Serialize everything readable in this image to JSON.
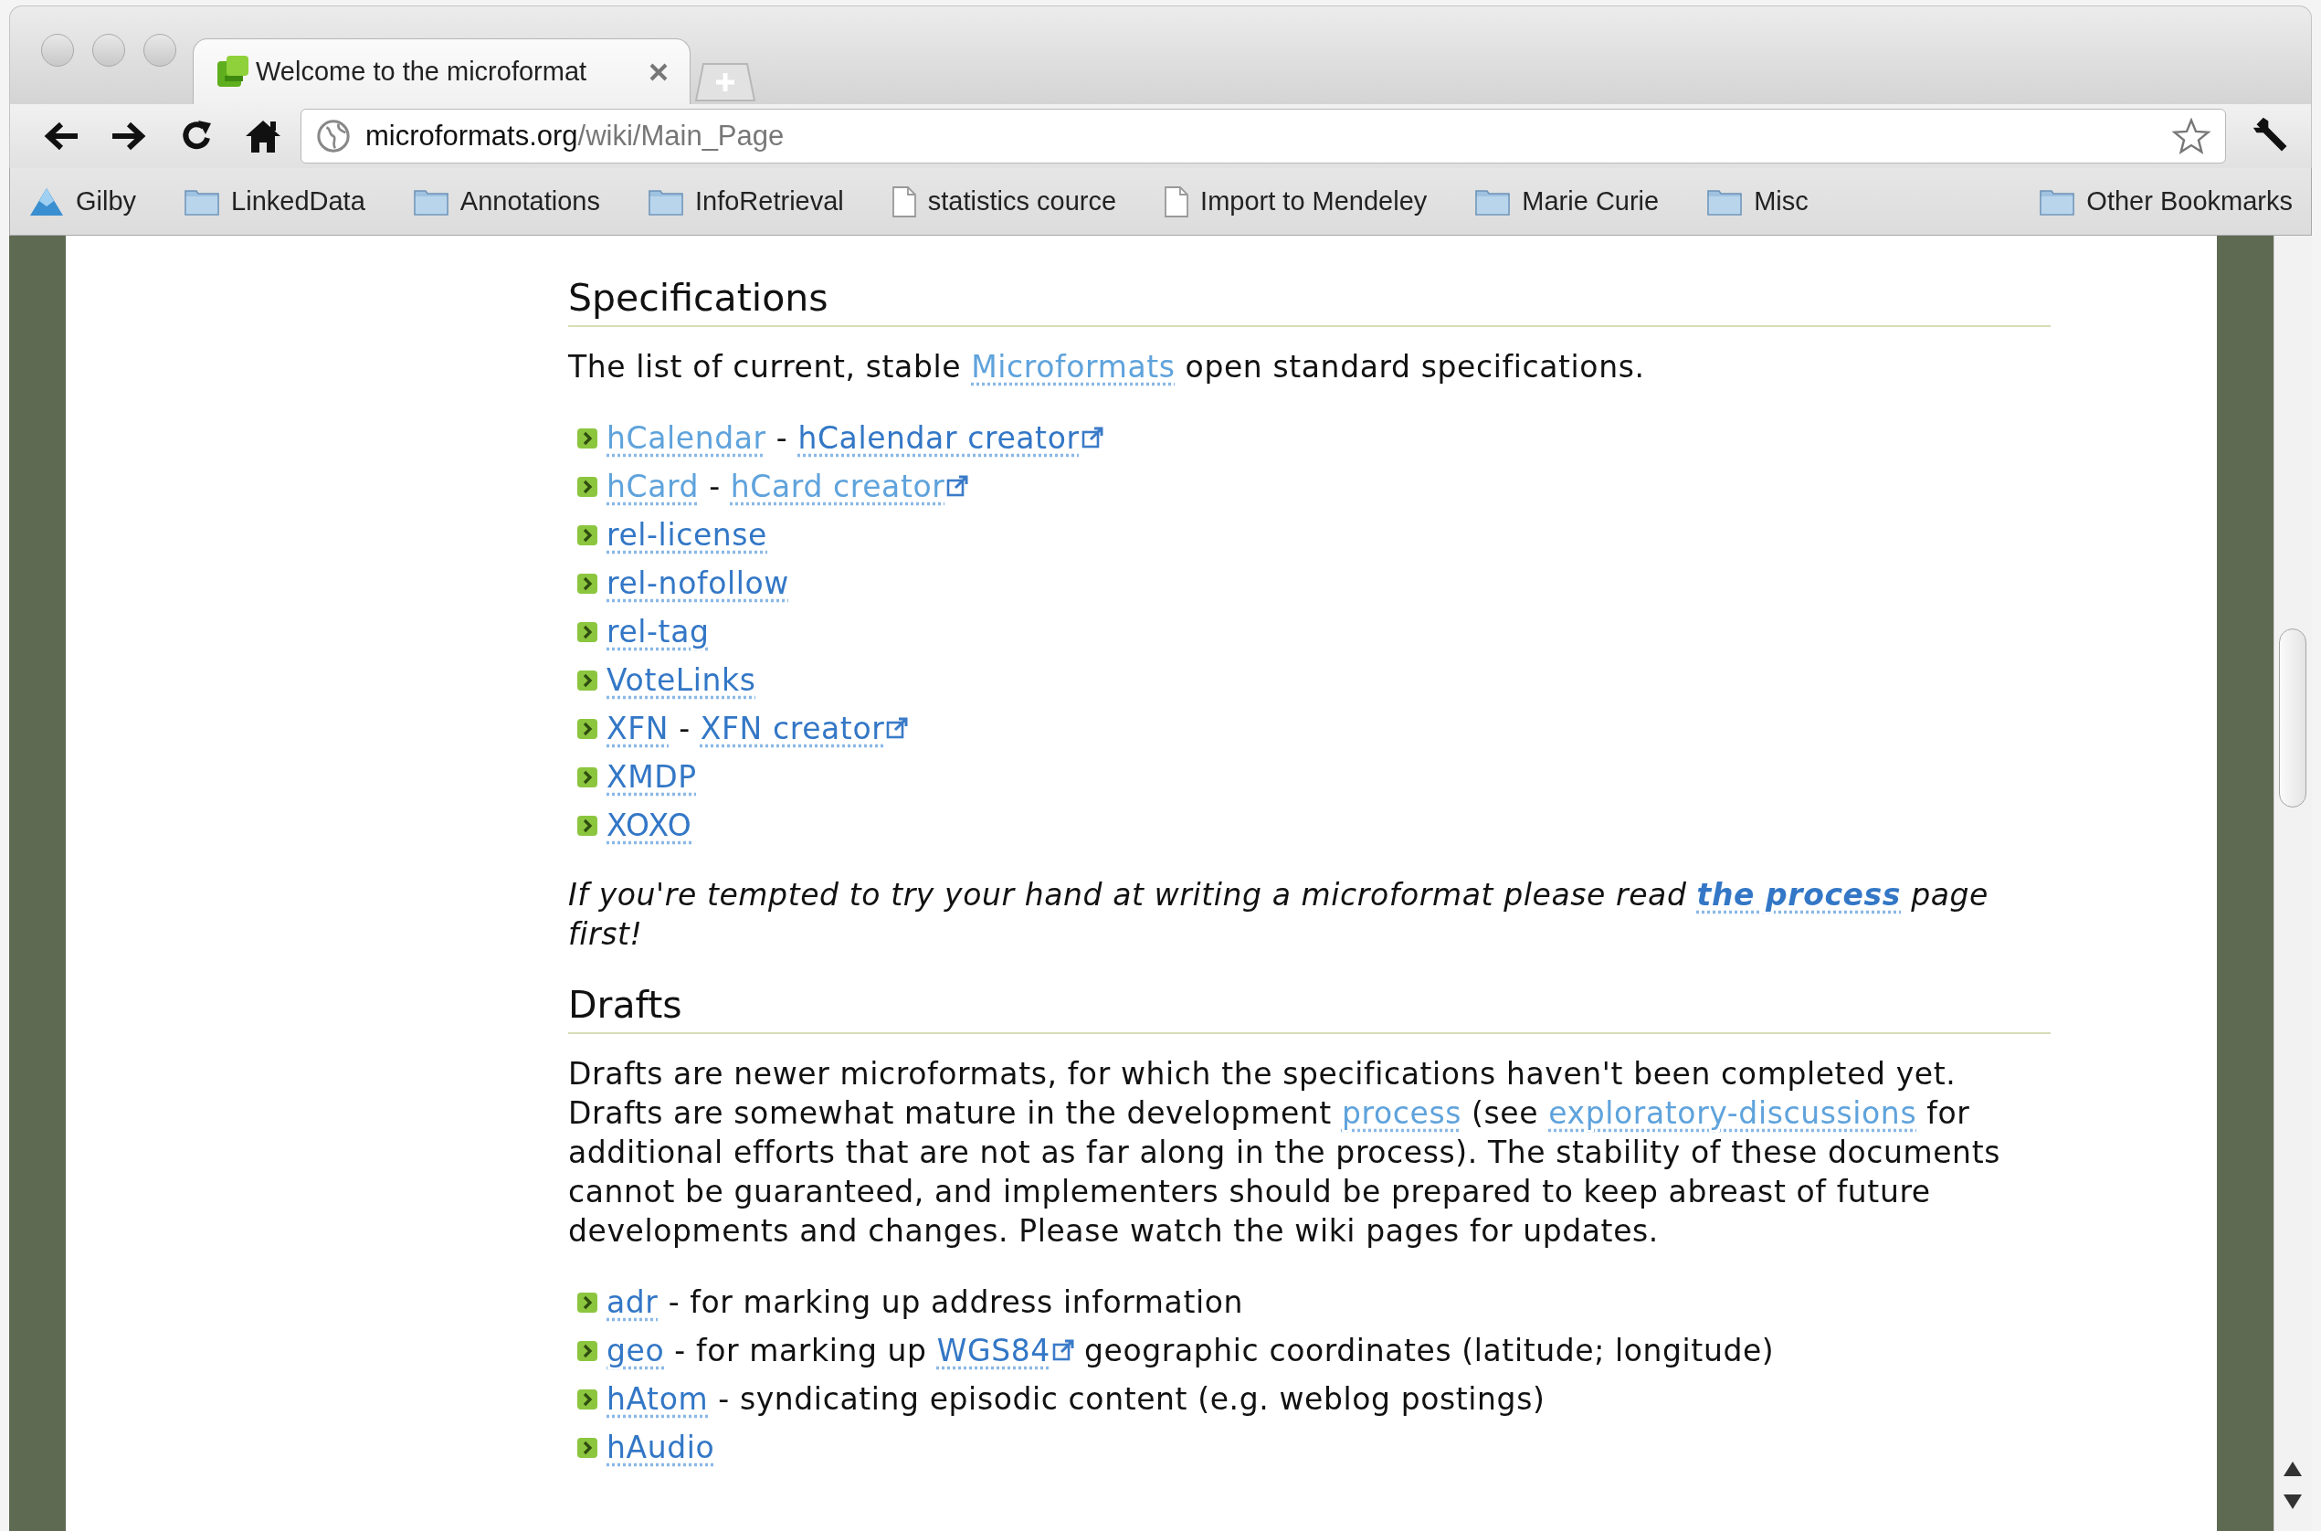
{
  "browser": {
    "tab": {
      "title": "Welcome to the microformat",
      "selected": true
    },
    "address": {
      "host": "microformats.org",
      "path": "/wiki/Main_Page"
    },
    "bookmarks": [
      {
        "label": "Gilby",
        "kind": "app"
      },
      {
        "label": "LinkedData",
        "kind": "folder"
      },
      {
        "label": "Annotations",
        "kind": "folder"
      },
      {
        "label": "InfoRetrieval",
        "kind": "folder"
      },
      {
        "label": "statistics cource",
        "kind": "page"
      },
      {
        "label": "Import to Mendeley",
        "kind": "page"
      },
      {
        "label": "Marie Curie",
        "kind": "folder"
      },
      {
        "label": "Misc",
        "kind": "folder"
      }
    ],
    "other_bookmarks": {
      "label": "Other Bookmarks",
      "kind": "folder"
    }
  },
  "page": {
    "sections": [
      {
        "heading": "Specifications",
        "blocks": [
          {
            "kind": "paragraph",
            "italic": false,
            "runs": [
              {
                "kind": "text",
                "text": "The list of current, stable "
              },
              {
                "kind": "link",
                "text": "Microformats",
                "visited": true,
                "external": false,
                "bold": false
              },
              {
                "kind": "text",
                "text": " open standard specifications."
              }
            ]
          },
          {
            "kind": "list",
            "items": [
              {
                "runs": [
                  {
                    "kind": "link",
                    "text": "hCalendar",
                    "visited": true,
                    "external": false,
                    "bold": false
                  },
                  {
                    "kind": "text",
                    "text": " - "
                  },
                  {
                    "kind": "link",
                    "text": "hCalendar creator",
                    "visited": false,
                    "external": true,
                    "bold": false
                  }
                ]
              },
              {
                "runs": [
                  {
                    "kind": "link",
                    "text": "hCard",
                    "visited": true,
                    "external": false,
                    "bold": false
                  },
                  {
                    "kind": "text",
                    "text": " - "
                  },
                  {
                    "kind": "link",
                    "text": "hCard creator",
                    "visited": true,
                    "external": true,
                    "bold": false
                  }
                ]
              },
              {
                "runs": [
                  {
                    "kind": "link",
                    "text": "rel-license",
                    "visited": false,
                    "external": false,
                    "bold": false
                  }
                ]
              },
              {
                "runs": [
                  {
                    "kind": "link",
                    "text": "rel-nofollow",
                    "visited": false,
                    "external": false,
                    "bold": false
                  }
                ]
              },
              {
                "runs": [
                  {
                    "kind": "link",
                    "text": "rel-tag",
                    "visited": false,
                    "external": false,
                    "bold": false
                  }
                ]
              },
              {
                "runs": [
                  {
                    "kind": "link",
                    "text": "VoteLinks",
                    "visited": false,
                    "external": false,
                    "bold": false
                  }
                ]
              },
              {
                "runs": [
                  {
                    "kind": "link",
                    "text": "XFN",
                    "visited": false,
                    "external": false,
                    "bold": false
                  },
                  {
                    "kind": "text",
                    "text": " - "
                  },
                  {
                    "kind": "link",
                    "text": "XFN creator",
                    "visited": false,
                    "external": true,
                    "bold": false
                  }
                ]
              },
              {
                "runs": [
                  {
                    "kind": "link",
                    "text": "XMDP",
                    "visited": false,
                    "external": false,
                    "bold": false
                  }
                ]
              },
              {
                "runs": [
                  {
                    "kind": "link",
                    "text": "XOXO",
                    "visited": false,
                    "external": false,
                    "bold": false
                  }
                ]
              }
            ]
          },
          {
            "kind": "paragraph",
            "italic": true,
            "runs": [
              {
                "kind": "text",
                "text": "If you're tempted to try your hand at writing a microformat please read "
              },
              {
                "kind": "link",
                "text": "the process",
                "visited": false,
                "external": false,
                "bold": true
              },
              {
                "kind": "text",
                "text": " page first!"
              }
            ]
          }
        ]
      },
      {
        "heading": "Drafts",
        "blocks": [
          {
            "kind": "paragraph",
            "italic": false,
            "runs": [
              {
                "kind": "text",
                "text": "Drafts are newer microformats, for which the specifications haven't been completed yet. Drafts are somewhat mature in the development "
              },
              {
                "kind": "link",
                "text": "process",
                "visited": true,
                "external": false,
                "bold": false
              },
              {
                "kind": "text",
                "text": " (see "
              },
              {
                "kind": "link",
                "text": "exploratory-discussions",
                "visited": true,
                "external": false,
                "bold": false
              },
              {
                "kind": "text",
                "text": " for additional efforts that are not as far along in the process). The stability of these documents cannot be guaranteed, and implementers should be prepared to keep abreast of future developments and changes. Please watch the wiki pages for updates."
              }
            ]
          },
          {
            "kind": "list",
            "items": [
              {
                "runs": [
                  {
                    "kind": "link",
                    "text": "adr",
                    "visited": false,
                    "external": false,
                    "bold": false
                  },
                  {
                    "kind": "text",
                    "text": " - for marking up address information"
                  }
                ]
              },
              {
                "runs": [
                  {
                    "kind": "link",
                    "text": "geo",
                    "visited": false,
                    "external": false,
                    "bold": false
                  },
                  {
                    "kind": "text",
                    "text": " - for marking up "
                  },
                  {
                    "kind": "link",
                    "text": "WGS84",
                    "visited": false,
                    "external": true,
                    "bold": false
                  },
                  {
                    "kind": "text",
                    "text": " geographic coordinates (latitude; longitude)"
                  }
                ]
              },
              {
                "runs": [
                  {
                    "kind": "link",
                    "text": "hAtom",
                    "visited": false,
                    "external": false,
                    "bold": false
                  },
                  {
                    "kind": "text",
                    "text": " - syndicating episodic content (e.g. weblog postings)"
                  }
                ]
              },
              {
                "runs": [
                  {
                    "kind": "link",
                    "text": "hAudio",
                    "visited": false,
                    "external": false,
                    "bold": false
                  }
                ]
              }
            ]
          }
        ]
      }
    ]
  }
}
